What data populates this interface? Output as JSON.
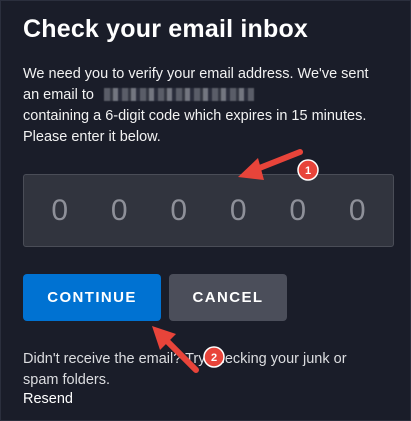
{
  "dialog": {
    "title": "Check your email inbox",
    "description_line1": "We need you to verify your email address. We've sent",
    "description_line2_prefix": "an email to",
    "description_line3": "containing a 6-digit code which expires in 15 minutes.",
    "description_line4": "Please enter it below."
  },
  "code_input": {
    "digits": [
      "0",
      "0",
      "0",
      "0",
      "0",
      "0"
    ]
  },
  "buttons": {
    "continue_label": "CONTINUE",
    "cancel_label": "CANCEL"
  },
  "help": {
    "line1": "Didn't receive the email? Try checking your junk or",
    "line2": "spam folders.",
    "resend_label": "Resend"
  },
  "annotations": {
    "badge1": "1",
    "badge2": "2",
    "color": "#e8443a"
  },
  "colors": {
    "background": "#1a1d29",
    "primary_button": "#0072d2",
    "secondary_button": "#4b4e5a",
    "input_background": "#31343e"
  }
}
